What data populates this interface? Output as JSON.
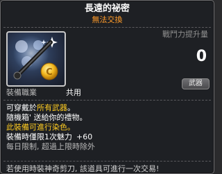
{
  "item": {
    "name": "長遠的祕密",
    "trade_status": "無法交換",
    "icon": "scissors-with-gold-coin-icon"
  },
  "power": {
    "label": "戰鬥力提升量",
    "value": "0"
  },
  "category": "武器",
  "job": {
    "label": "裝備職業",
    "value": "共用"
  },
  "description": {
    "line1_prefix": "可穿戴於",
    "line1_highlight": "所有武器",
    "line1_suffix": "。",
    "line2": "隨機箱' 送給你的禮物。",
    "line3": "此裝備可進行染色。",
    "line4_text": "裝備時僅限1次魅力",
    "line4_bonus": "+60",
    "line5": "每日限制, 超過上限時除外"
  },
  "footer": "若使用時裝神奇剪刀, 該道具可進行一次交易!",
  "colors": {
    "title": "#ffffff",
    "trade_status": "#ff9b2a",
    "highlight": "#ffcc22",
    "muted": "#8f8f8f"
  }
}
